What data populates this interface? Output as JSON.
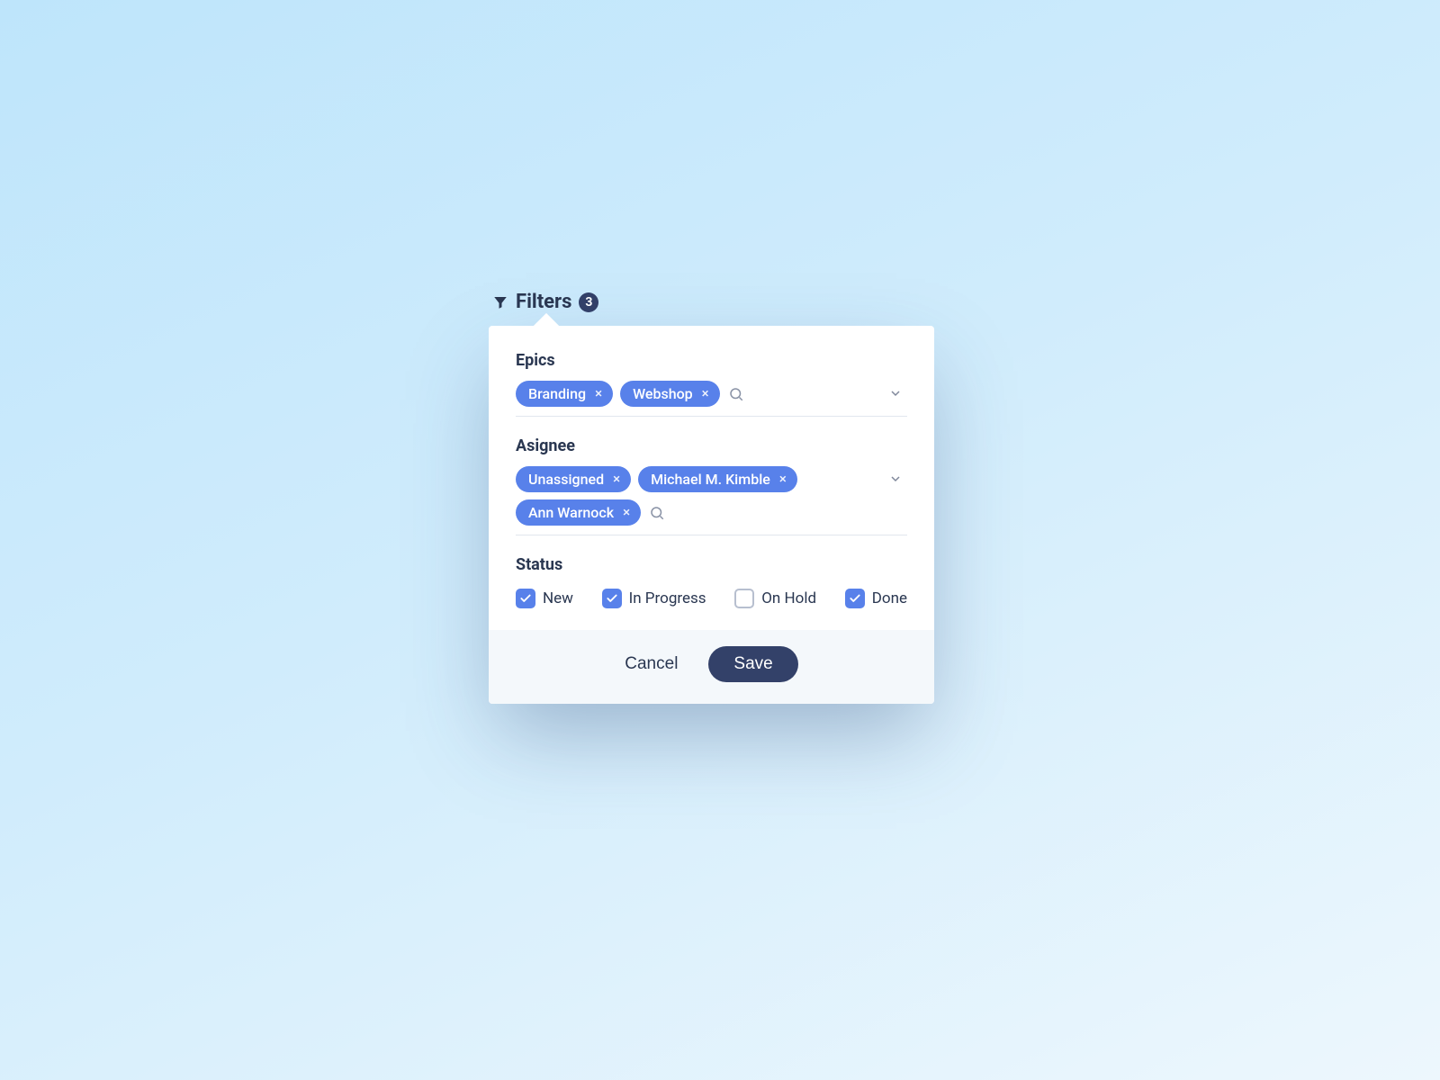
{
  "trigger": {
    "label": "Filters",
    "count": "3"
  },
  "sections": {
    "epics": {
      "label": "Epics",
      "chips": [
        "Branding",
        "Webshop"
      ]
    },
    "assignee": {
      "label": "Asignee",
      "chips": [
        "Unassigned",
        "Michael M. Kimble",
        "Ann Warnock"
      ]
    },
    "status": {
      "label": "Status",
      "options": [
        {
          "label": "New",
          "checked": true
        },
        {
          "label": "In Progress",
          "checked": true
        },
        {
          "label": "On Hold",
          "checked": false
        },
        {
          "label": "Done",
          "checked": true
        }
      ]
    }
  },
  "footer": {
    "cancel": "Cancel",
    "save": "Save"
  },
  "colors": {
    "accent": "#5881ea",
    "dark": "#334169"
  }
}
